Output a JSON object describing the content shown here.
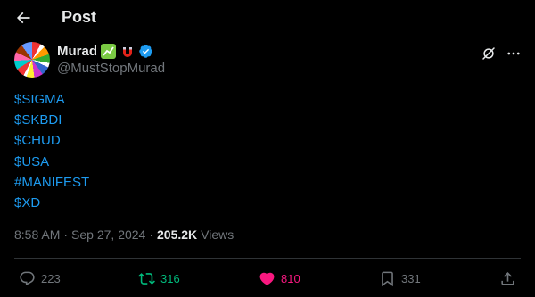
{
  "header": {
    "title": "Post",
    "back_icon": "arrow-left-icon"
  },
  "author": {
    "display_name": "Murad",
    "handle": "@MustStopMurad",
    "badges": [
      "chart-increasing-emoji",
      "magnet-emoji"
    ],
    "verified": true,
    "verified_color": "#1d9bf0"
  },
  "post": {
    "lines": [
      "$SIGMA",
      "$SKBDI",
      "$CHUD",
      "$USA",
      "#MANIFEST",
      "$XD"
    ],
    "link_color": "#1d9bf0"
  },
  "meta": {
    "time": "8:58 AM",
    "separator": "·",
    "date": "Sep 27, 2024",
    "views_count": "205.2K",
    "views_label": "Views"
  },
  "actions": {
    "replies": "223",
    "reposts": "316",
    "likes": "810",
    "bookmarks": "331",
    "repost_color": "#00ba7c",
    "like_color": "#f91880"
  },
  "colors": {
    "background": "#000000",
    "text_primary": "#e7e9ea",
    "text_secondary": "#71767b",
    "divider": "#2f3336"
  }
}
